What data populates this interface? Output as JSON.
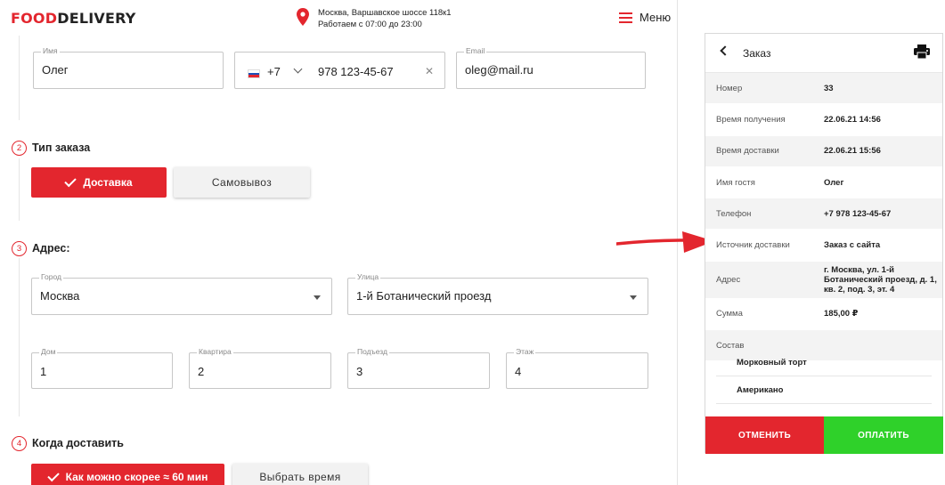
{
  "colors": {
    "accent": "#e3262e",
    "pay": "#2fd12a",
    "panel_bg": "#ffffff"
  },
  "header": {
    "logo_part1": "FOOD",
    "logo_part2": "DELIVERY",
    "address_line1": "Москва, Варшавское шоссе 118к1",
    "address_line2": "Работаем с 07:00 до 23:00",
    "menu_label": "Меню",
    "icons": {
      "pin": "map-pin-icon",
      "menu": "hamburger-icon"
    }
  },
  "contacts": {
    "name_label": "Имя",
    "name_value": "Олег",
    "phone_code": "+7",
    "phone_value": "978 123-45-67",
    "email_label": "Email",
    "email_value": "oleg@mail.ru"
  },
  "order_type": {
    "step": "2",
    "title": "Тип заказа",
    "delivery_label": "Доставка",
    "pickup_label": "Самовывоз",
    "selected": "Доставка"
  },
  "address": {
    "step": "3",
    "title": "Адрес:",
    "city_label": "Город",
    "city_value": "Москва",
    "street_label": "Улица",
    "street_value": "1-й Ботанический проезд",
    "house_label": "Дом",
    "house_value": "1",
    "apartment_label": "Квартира",
    "apartment_value": "2",
    "entrance_label": "Подъезд",
    "entrance_value": "3",
    "floor_label": "Этаж",
    "floor_value": "4"
  },
  "when": {
    "step": "4",
    "title": "Когда доставить",
    "asap_label": "Как можно скорее ≈ 60 мин",
    "choose_time_label": "Выбрать время"
  },
  "order_panel": {
    "title": "Заказ",
    "rows": [
      {
        "key": "Номер",
        "value": "33"
      },
      {
        "key": "Время получения",
        "value": "22.06.21 14:56"
      },
      {
        "key": "Время доставки",
        "value": "22.06.21 15:56"
      },
      {
        "key": "Имя гостя",
        "value": "Олег"
      },
      {
        "key": "Телефон",
        "value": "+7 978 123-45-67"
      },
      {
        "key": "Источник доставки",
        "value": "Заказ с сайта"
      },
      {
        "key": "Адрес",
        "value": "г. Москва, ул. 1-й Ботанический проезд, д. 1, кв. 2, под. 3, эт. 4"
      },
      {
        "key": "Сумма",
        "value": "185,00 ₽"
      },
      {
        "key": "Состав",
        "value": ""
      }
    ],
    "items": [
      "Морковный торт",
      "Американо"
    ],
    "cancel_label": "ОТМЕНИТЬ",
    "pay_label": "ОПЛАТИТЬ"
  }
}
